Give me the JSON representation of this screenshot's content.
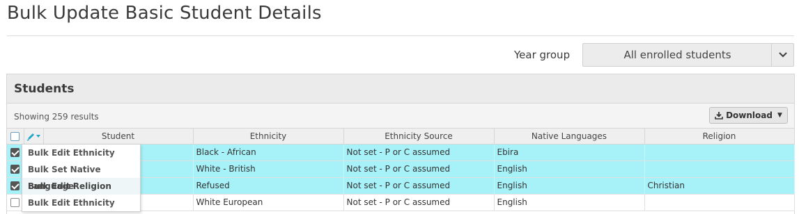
{
  "page": {
    "title": "Bulk Update Basic Student Details"
  },
  "filter": {
    "label": "Year group",
    "selected": "All enrolled students"
  },
  "panel": {
    "title": "Students",
    "results": "Showing 259 results",
    "download_label": "Download"
  },
  "table": {
    "headers": [
      "Student",
      "Ethnicity",
      "Ethnicity Source",
      "Native Languages",
      "Religion"
    ],
    "rows": [
      {
        "checked": true,
        "student": "",
        "ethnicity": "Black - African",
        "source": "Not set - P or C assumed",
        "language": "Ebira",
        "religion": ""
      },
      {
        "checked": true,
        "student": "",
        "ethnicity": "White - British",
        "source": "Not set - P or C assumed",
        "language": "English",
        "religion": ""
      },
      {
        "checked": true,
        "student": "",
        "ethnicity": "Refused",
        "source": "Not set - P or C assumed",
        "language": "English",
        "religion": "Christian"
      },
      {
        "checked": false,
        "student": "",
        "ethnicity": "White European",
        "source": "Not set - P or C assumed",
        "language": "English",
        "religion": ""
      }
    ]
  },
  "bulk_menu": {
    "items": [
      "Bulk Edit Ethnicity",
      "Bulk Set Native Language",
      "Bulk Edit Religion",
      "Bulk Edit Ethnicity Source"
    ]
  },
  "icons": {
    "chevron": "chevron-down-icon",
    "download": "download-icon",
    "bulk_edit": "pencil-icon"
  },
  "colors": {
    "selected_row": "#a7f2f8",
    "pencil": "#1fa7c9"
  }
}
